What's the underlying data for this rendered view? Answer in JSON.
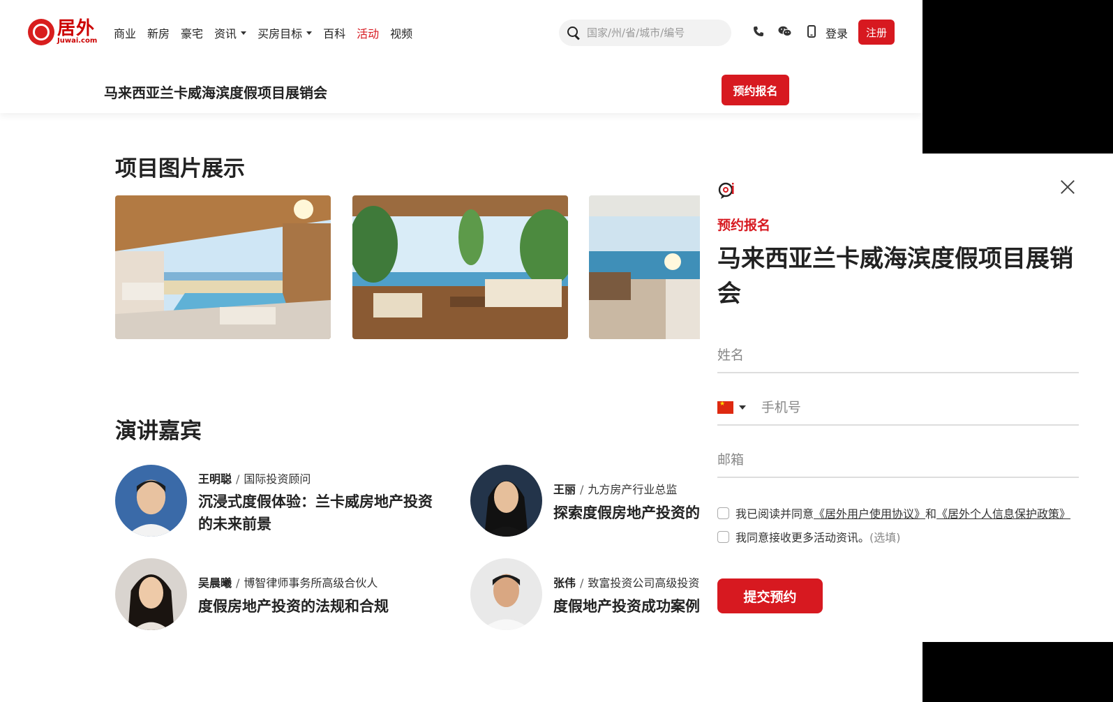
{
  "brand": {
    "logo_cn": "居外",
    "logo_en": "Juwai.com"
  },
  "nav": {
    "items": [
      {
        "label": "商业",
        "active": false,
        "dropdown": false
      },
      {
        "label": "新房",
        "active": false,
        "dropdown": false
      },
      {
        "label": "豪宅",
        "active": false,
        "dropdown": false
      },
      {
        "label": "资讯",
        "active": false,
        "dropdown": true
      },
      {
        "label": "买房目标",
        "active": false,
        "dropdown": true
      },
      {
        "label": "百科",
        "active": false,
        "dropdown": false
      },
      {
        "label": "活动",
        "active": true,
        "dropdown": false
      },
      {
        "label": "视频",
        "active": false,
        "dropdown": false
      }
    ]
  },
  "search": {
    "placeholder": "国家/州/省/城市/编号",
    "value": ""
  },
  "header": {
    "login": "登录",
    "register": "注册",
    "icons": [
      "phone-icon",
      "wechat-icon",
      "mobile-icon"
    ]
  },
  "event": {
    "title": "马来西亚兰卡威海滨度假项目展销会",
    "book_label": "预约报名"
  },
  "gallery": {
    "heading": "项目图片展示"
  },
  "speakers": {
    "heading": "演讲嘉宾",
    "items": [
      {
        "name": "王明聪",
        "role": "国际投资顾问",
        "talk": "沉浸式度假体验：兰卡威房地产投资的未来前景"
      },
      {
        "name": "王丽",
        "role": "九方房产行业总监",
        "talk": "探索度假房地产投资的"
      },
      {
        "name": "吴晨曦",
        "role": "博智律师事务所高级合伙人",
        "talk": "度假房地产投资的法规和合规"
      },
      {
        "name": "张伟",
        "role": "致富投资公司高级投资",
        "talk": "度假地产投资成功案例"
      }
    ]
  },
  "modal": {
    "kicker": "预约报名",
    "title": "马来西亚兰卡威海滨度假项目展销会",
    "name_placeholder": "姓名",
    "phone_placeholder": "手机号",
    "email_placeholder": "邮箱",
    "agree_prefix": "我已阅读并同意",
    "agree_link1": "《居外用户使用协议》",
    "agree_and": "和",
    "agree_link2": "《居外个人信息保护政策》",
    "optin_text": "我同意接收更多活动资讯。",
    "optin_optional": "(选填)",
    "submit_label": "提交预约"
  },
  "colors": {
    "brand_red": "#d71920",
    "text": "#222222"
  }
}
